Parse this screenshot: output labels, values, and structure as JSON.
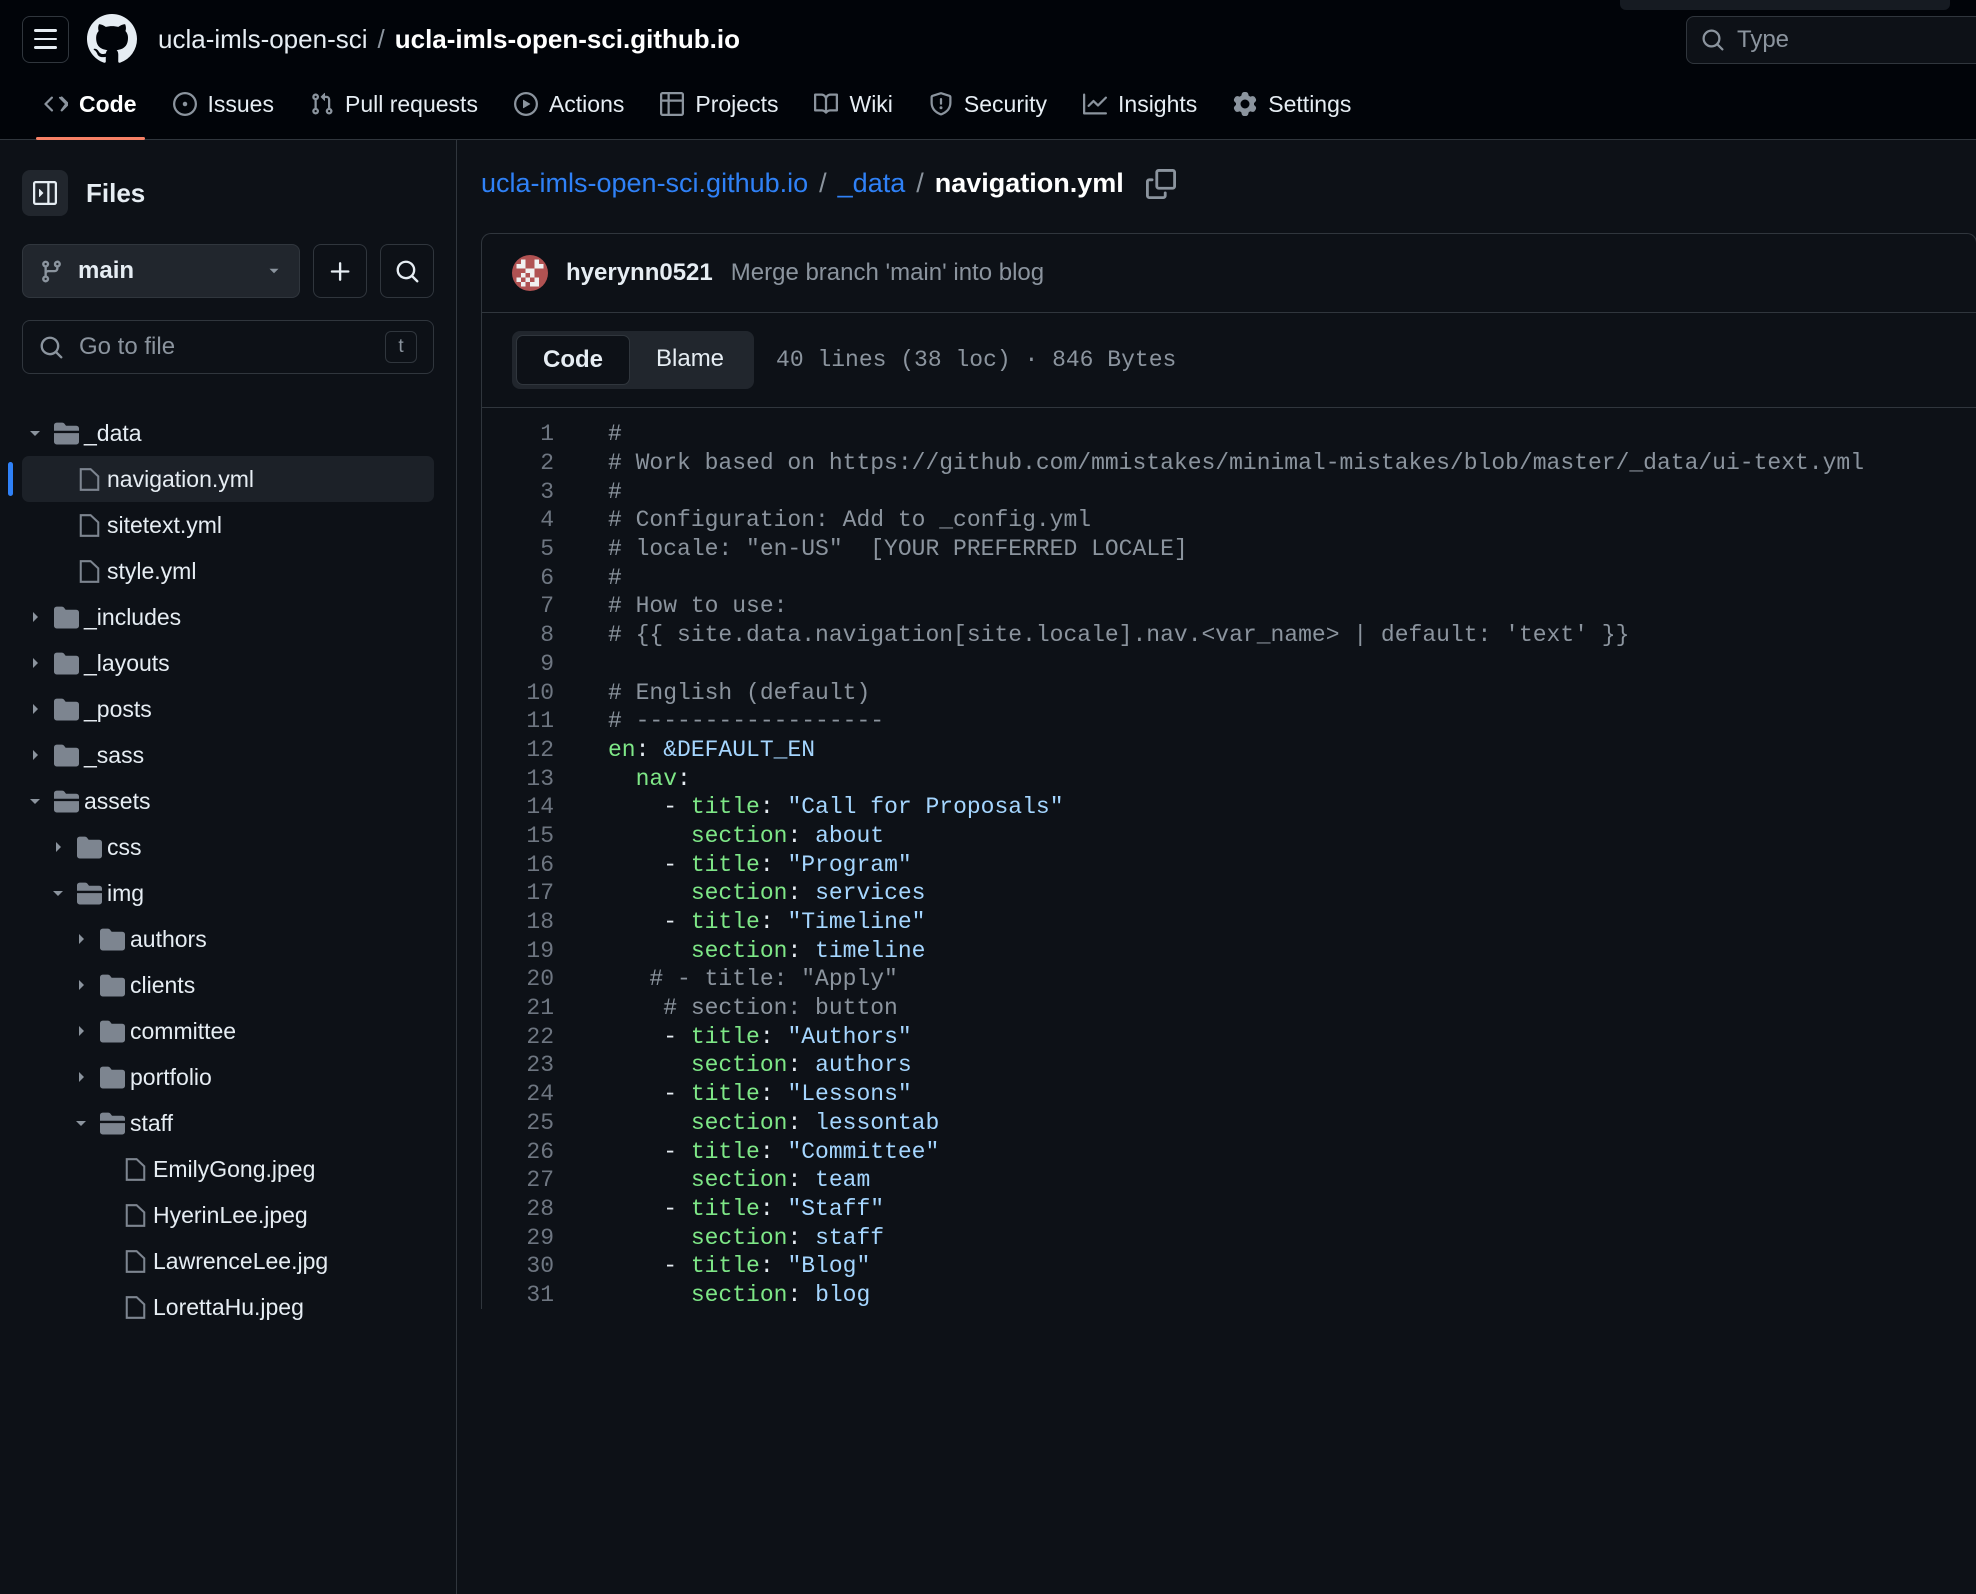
{
  "header": {
    "menu_icon": "hamburger-icon",
    "logo_icon": "github-logo-icon",
    "owner": "ucla-imls-open-sci",
    "separator": "/",
    "repo": "ucla-imls-open-sci.github.io",
    "search_icon": "search-icon",
    "search_placeholder": "Type"
  },
  "repo_nav": [
    {
      "label": "Code",
      "icon": "code-icon",
      "active": true
    },
    {
      "label": "Issues",
      "icon": "issue-opened-icon",
      "active": false
    },
    {
      "label": "Pull requests",
      "icon": "git-pull-request-icon",
      "active": false
    },
    {
      "label": "Actions",
      "icon": "play-icon",
      "active": false
    },
    {
      "label": "Projects",
      "icon": "table-icon",
      "active": false
    },
    {
      "label": "Wiki",
      "icon": "book-icon",
      "active": false
    },
    {
      "label": "Security",
      "icon": "shield-icon",
      "active": false
    },
    {
      "label": "Insights",
      "icon": "graph-icon",
      "active": false
    },
    {
      "label": "Settings",
      "icon": "gear-icon",
      "active": false
    }
  ],
  "sidebar": {
    "collapse_icon": "sidebar-collapse-icon",
    "title": "Files",
    "branch": {
      "icon": "git-branch-icon",
      "name": "main",
      "chevron": "chevron-down-icon"
    },
    "add_button_icon": "plus-icon",
    "search_button_icon": "search-icon",
    "go_to_file": {
      "icon": "search-icon",
      "placeholder": "Go to file",
      "shortcut": "t"
    },
    "tree": [
      {
        "label": "_data",
        "type": "folder-open",
        "depth": 0,
        "chevron": "chevron-down",
        "selected": false
      },
      {
        "label": "navigation.yml",
        "type": "file",
        "depth": 1,
        "chevron": "none",
        "selected": true
      },
      {
        "label": "sitetext.yml",
        "type": "file",
        "depth": 1,
        "chevron": "none",
        "selected": false
      },
      {
        "label": "style.yml",
        "type": "file",
        "depth": 1,
        "chevron": "none",
        "selected": false
      },
      {
        "label": "_includes",
        "type": "folder",
        "depth": 0,
        "chevron": "chevron-right",
        "selected": false
      },
      {
        "label": "_layouts",
        "type": "folder",
        "depth": 0,
        "chevron": "chevron-right",
        "selected": false
      },
      {
        "label": "_posts",
        "type": "folder",
        "depth": 0,
        "chevron": "chevron-right",
        "selected": false
      },
      {
        "label": "_sass",
        "type": "folder",
        "depth": 0,
        "chevron": "chevron-right",
        "selected": false
      },
      {
        "label": "assets",
        "type": "folder-open",
        "depth": 0,
        "chevron": "chevron-down",
        "selected": false
      },
      {
        "label": "css",
        "type": "folder",
        "depth": 1,
        "chevron": "chevron-right",
        "selected": false
      },
      {
        "label": "img",
        "type": "folder-open",
        "depth": 1,
        "chevron": "chevron-down",
        "selected": false
      },
      {
        "label": "authors",
        "type": "folder",
        "depth": 2,
        "chevron": "chevron-right",
        "selected": false
      },
      {
        "label": "clients",
        "type": "folder",
        "depth": 2,
        "chevron": "chevron-right",
        "selected": false
      },
      {
        "label": "committee",
        "type": "folder",
        "depth": 2,
        "chevron": "chevron-right",
        "selected": false
      },
      {
        "label": "portfolio",
        "type": "folder",
        "depth": 2,
        "chevron": "chevron-right",
        "selected": false
      },
      {
        "label": "staff",
        "type": "folder-open",
        "depth": 2,
        "chevron": "chevron-down",
        "selected": false
      },
      {
        "label": "EmilyGong.jpeg",
        "type": "file",
        "depth": 3,
        "chevron": "none",
        "selected": false
      },
      {
        "label": "HyerinLee.jpeg",
        "type": "file",
        "depth": 3,
        "chevron": "none",
        "selected": false
      },
      {
        "label": "LawrenceLee.jpg",
        "type": "file",
        "depth": 3,
        "chevron": "none",
        "selected": false
      },
      {
        "label": "LorettaHu.jpeg",
        "type": "file",
        "depth": 3,
        "chevron": "none",
        "selected": false
      }
    ]
  },
  "main": {
    "breadcrumb": {
      "repo": "ucla-imls-open-sci.github.io",
      "folder": "_data",
      "file": "navigation.yml",
      "copy_icon": "copy-path-icon"
    },
    "commit": {
      "avatar_icon": "user-avatar-identicon",
      "author": "hyerynn0521",
      "message": "Merge branch 'main' into blog"
    },
    "toolbar": {
      "tabs": [
        {
          "label": "Code",
          "active": true
        },
        {
          "label": "Blame",
          "active": false
        }
      ],
      "file_meta": "40 lines (38 loc) · 846 Bytes"
    },
    "code": [
      {
        "n": "1",
        "segments": [
          {
            "t": "#",
            "c": "c-com"
          }
        ]
      },
      {
        "n": "2",
        "segments": [
          {
            "t": "# Work based on https://github.com/mmistakes/minimal-mistakes/blob/master/_data/ui-text.yml",
            "c": "c-com"
          }
        ]
      },
      {
        "n": "3",
        "segments": [
          {
            "t": "#",
            "c": "c-com"
          }
        ]
      },
      {
        "n": "4",
        "segments": [
          {
            "t": "# Configuration: Add to _config.yml",
            "c": "c-com"
          }
        ]
      },
      {
        "n": "5",
        "segments": [
          {
            "t": "# locale: \"en-US\"  [YOUR PREFERRED LOCALE]",
            "c": "c-com"
          }
        ]
      },
      {
        "n": "6",
        "segments": [
          {
            "t": "#",
            "c": "c-com"
          }
        ]
      },
      {
        "n": "7",
        "segments": [
          {
            "t": "# How to use:",
            "c": "c-com"
          }
        ]
      },
      {
        "n": "8",
        "segments": [
          {
            "t": "# {{ site.data.navigation[site.locale].nav.<var_name> | default: 'text' }}",
            "c": "c-com"
          }
        ]
      },
      {
        "n": "9",
        "segments": [
          {
            "t": "",
            "c": "c-pun"
          }
        ]
      },
      {
        "n": "10",
        "segments": [
          {
            "t": "# English (default)",
            "c": "c-com"
          }
        ]
      },
      {
        "n": "11",
        "segments": [
          {
            "t": "# ------------------",
            "c": "c-com"
          }
        ]
      },
      {
        "n": "12",
        "segments": [
          {
            "t": "en",
            "c": "c-key"
          },
          {
            "t": ": ",
            "c": "c-pun"
          },
          {
            "t": "&DEFAULT_EN",
            "c": "c-val"
          }
        ]
      },
      {
        "n": "13",
        "segments": [
          {
            "t": "  ",
            "c": "c-pun"
          },
          {
            "t": "nav",
            "c": "c-key"
          },
          {
            "t": ":",
            "c": "c-pun"
          }
        ]
      },
      {
        "n": "14",
        "segments": [
          {
            "t": "    - ",
            "c": "c-pun"
          },
          {
            "t": "title",
            "c": "c-key"
          },
          {
            "t": ": ",
            "c": "c-pun"
          },
          {
            "t": "\"Call for Proposals\"",
            "c": "c-val"
          }
        ]
      },
      {
        "n": "15",
        "segments": [
          {
            "t": "      ",
            "c": "c-pun"
          },
          {
            "t": "section",
            "c": "c-key"
          },
          {
            "t": ": ",
            "c": "c-pun"
          },
          {
            "t": "about",
            "c": "c-val"
          }
        ]
      },
      {
        "n": "16",
        "segments": [
          {
            "t": "    - ",
            "c": "c-pun"
          },
          {
            "t": "title",
            "c": "c-key"
          },
          {
            "t": ": ",
            "c": "c-pun"
          },
          {
            "t": "\"Program\"",
            "c": "c-val"
          }
        ]
      },
      {
        "n": "17",
        "segments": [
          {
            "t": "      ",
            "c": "c-pun"
          },
          {
            "t": "section",
            "c": "c-key"
          },
          {
            "t": ": ",
            "c": "c-pun"
          },
          {
            "t": "services",
            "c": "c-val"
          }
        ]
      },
      {
        "n": "18",
        "segments": [
          {
            "t": "    - ",
            "c": "c-pun"
          },
          {
            "t": "title",
            "c": "c-key"
          },
          {
            "t": ": ",
            "c": "c-pun"
          },
          {
            "t": "\"Timeline\"",
            "c": "c-val"
          }
        ]
      },
      {
        "n": "19",
        "segments": [
          {
            "t": "      ",
            "c": "c-pun"
          },
          {
            "t": "section",
            "c": "c-key"
          },
          {
            "t": ": ",
            "c": "c-pun"
          },
          {
            "t": "timeline",
            "c": "c-val"
          }
        ]
      },
      {
        "n": "20",
        "segments": [
          {
            "t": "   # - title: \"Apply\"",
            "c": "c-com"
          }
        ]
      },
      {
        "n": "21",
        "segments": [
          {
            "t": "    # section: button",
            "c": "c-com"
          }
        ]
      },
      {
        "n": "22",
        "segments": [
          {
            "t": "    - ",
            "c": "c-pun"
          },
          {
            "t": "title",
            "c": "c-key"
          },
          {
            "t": ": ",
            "c": "c-pun"
          },
          {
            "t": "\"Authors\"",
            "c": "c-val"
          }
        ]
      },
      {
        "n": "23",
        "segments": [
          {
            "t": "      ",
            "c": "c-pun"
          },
          {
            "t": "section",
            "c": "c-key"
          },
          {
            "t": ": ",
            "c": "c-pun"
          },
          {
            "t": "authors",
            "c": "c-val"
          }
        ]
      },
      {
        "n": "24",
        "segments": [
          {
            "t": "    - ",
            "c": "c-pun"
          },
          {
            "t": "title",
            "c": "c-key"
          },
          {
            "t": ": ",
            "c": "c-pun"
          },
          {
            "t": "\"Lessons\"",
            "c": "c-val"
          }
        ]
      },
      {
        "n": "25",
        "segments": [
          {
            "t": "      ",
            "c": "c-pun"
          },
          {
            "t": "section",
            "c": "c-key"
          },
          {
            "t": ": ",
            "c": "c-pun"
          },
          {
            "t": "lessontab",
            "c": "c-val"
          }
        ]
      },
      {
        "n": "26",
        "segments": [
          {
            "t": "    - ",
            "c": "c-pun"
          },
          {
            "t": "title",
            "c": "c-key"
          },
          {
            "t": ": ",
            "c": "c-pun"
          },
          {
            "t": "\"Committee\"",
            "c": "c-val"
          }
        ]
      },
      {
        "n": "27",
        "segments": [
          {
            "t": "      ",
            "c": "c-pun"
          },
          {
            "t": "section",
            "c": "c-key"
          },
          {
            "t": ": ",
            "c": "c-pun"
          },
          {
            "t": "team",
            "c": "c-val"
          }
        ]
      },
      {
        "n": "28",
        "segments": [
          {
            "t": "    - ",
            "c": "c-pun"
          },
          {
            "t": "title",
            "c": "c-key"
          },
          {
            "t": ": ",
            "c": "c-pun"
          },
          {
            "t": "\"Staff\"",
            "c": "c-val"
          }
        ]
      },
      {
        "n": "29",
        "segments": [
          {
            "t": "      ",
            "c": "c-pun"
          },
          {
            "t": "section",
            "c": "c-key"
          },
          {
            "t": ": ",
            "c": "c-pun"
          },
          {
            "t": "staff",
            "c": "c-val"
          }
        ]
      },
      {
        "n": "30",
        "segments": [
          {
            "t": "    - ",
            "c": "c-pun"
          },
          {
            "t": "title",
            "c": "c-key"
          },
          {
            "t": ": ",
            "c": "c-pun"
          },
          {
            "t": "\"Blog\"",
            "c": "c-val"
          }
        ]
      },
      {
        "n": "31",
        "segments": [
          {
            "t": "      ",
            "c": "c-pun"
          },
          {
            "t": "section",
            "c": "c-key"
          },
          {
            "t": ": ",
            "c": "c-pun"
          },
          {
            "t": "blog",
            "c": "c-val"
          }
        ]
      }
    ]
  },
  "colors": {
    "page_bg": "#0d1117",
    "header_bg": "#010409",
    "border": "#30363d",
    "accent_blue": "#2f81f7",
    "active_tab_underline": "#f78166",
    "syntax_key": "#7ee787",
    "syntax_value": "#a5d6ff",
    "syntax_comment": "#8b949e"
  }
}
